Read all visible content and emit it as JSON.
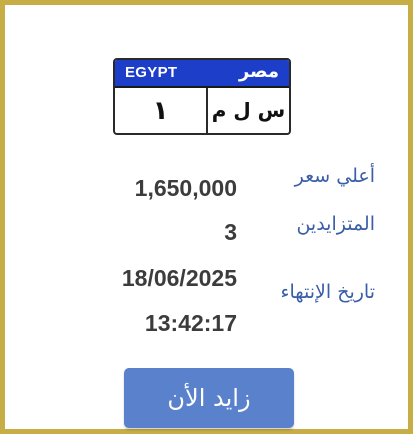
{
  "plate": {
    "country_en": "EGYPT",
    "country_ar": "مصر",
    "number": "١",
    "letters": "س ل م"
  },
  "details": {
    "highest_price_label": "أعلي سعر",
    "highest_price_value": "1,650,000",
    "bidders_label": "المتزايدين",
    "bidders_value": "3",
    "end_date_label": "تاريخ الإنتهاء",
    "end_date_value": "18/06/2025",
    "end_time_value": "13:42:17"
  },
  "bid_button_label": "زايد الأن",
  "colors": {
    "border": "#c7ad45",
    "plate_header": "#1d3ec9",
    "label_text": "#3a5ea8",
    "button": "#5981cc"
  }
}
